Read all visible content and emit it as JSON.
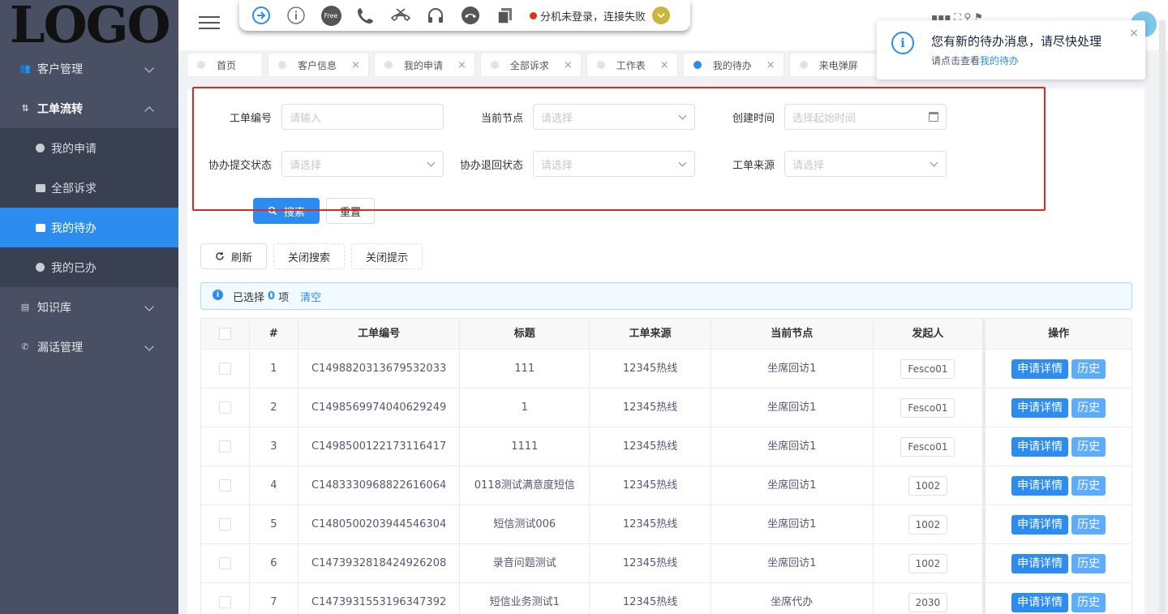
{
  "logo": {
    "text": "LOGO"
  },
  "sidebar": {
    "items": [
      {
        "label": "客户管理",
        "icon": "customer-icon",
        "open": false
      },
      {
        "label": "工单流转",
        "icon": "workflow-icon",
        "open": true,
        "children": [
          {
            "label": "我的申请",
            "icon": "dot-icon"
          },
          {
            "label": "全部诉求",
            "icon": "folder-icon"
          },
          {
            "label": "我的待办",
            "icon": "todo-icon",
            "active": true
          },
          {
            "label": "我的已办",
            "icon": "dot-icon"
          }
        ]
      },
      {
        "label": "知识库",
        "icon": "book-icon",
        "open": false
      },
      {
        "label": "漏话管理",
        "icon": "phone-icon",
        "open": false
      }
    ]
  },
  "phonebar": {
    "free_label": "Free",
    "status_text": "分机未登录，连接失败",
    "icons": [
      "login-icon",
      "info-icon",
      "free-icon",
      "call-icon",
      "hangup-icon",
      "headset-icon",
      "end-call-icon",
      "copy-icon"
    ]
  },
  "header": {
    "right_text": "▪▪▪ ⛶ ⚲ ⚑"
  },
  "tabs": [
    {
      "label": "首页",
      "closable": false,
      "active": false
    },
    {
      "label": "客户信息",
      "closable": true,
      "active": false
    },
    {
      "label": "我的申请",
      "closable": true,
      "active": false
    },
    {
      "label": "全部诉求",
      "closable": true,
      "active": false
    },
    {
      "label": "工作表",
      "closable": true,
      "active": false
    },
    {
      "label": "我的待办",
      "closable": true,
      "active": true
    },
    {
      "label": "来电弹屏",
      "closable": false,
      "active": false
    }
  ],
  "notice": {
    "title": "您有新的待办消息，请尽快处理",
    "desc_prefix": "请点击查看",
    "desc_link": "我的待办",
    "close": "×"
  },
  "search": {
    "fields": [
      {
        "label": "工单编号",
        "placeholder": "请输入",
        "type": "input"
      },
      {
        "label": "当前节点",
        "placeholder": "请选择",
        "type": "select"
      },
      {
        "label": "创建时间",
        "placeholder": "选择起始时间",
        "type": "date"
      },
      {
        "label": "协办提交状态",
        "placeholder": "请选择",
        "type": "select"
      },
      {
        "label": "协办退回状态",
        "placeholder": "请选择",
        "type": "select"
      },
      {
        "label": "工单来源",
        "placeholder": "请选择",
        "type": "select"
      }
    ],
    "search_button": "搜索",
    "reset_button": "重置"
  },
  "toolbar": {
    "refresh": "刷新",
    "close_search": "关闭搜索",
    "close_tip": "关闭提示"
  },
  "selection": {
    "prefix": "已选择",
    "count": "0",
    "suffix": "项",
    "clear": "清空"
  },
  "table": {
    "columns": [
      "",
      "#",
      "工单编号",
      "标题",
      "工单来源",
      "当前节点",
      "发起人",
      "操作"
    ],
    "action_detail": "申请详情",
    "action_history": "历史",
    "rows": [
      {
        "idx": "1",
        "no": "C1498820313679532033",
        "title": "111",
        "source": "12345热线",
        "node": "坐席回访1",
        "initiator": "Fesco01"
      },
      {
        "idx": "2",
        "no": "C1498569974040629249",
        "title": "1",
        "source": "12345热线",
        "node": "坐席回访1",
        "initiator": "Fesco01"
      },
      {
        "idx": "3",
        "no": "C1498500122173116417",
        "title": "1111",
        "source": "12345热线",
        "node": "坐席回访1",
        "initiator": "Fesco01"
      },
      {
        "idx": "4",
        "no": "C1483330968822616064",
        "title": "0118测试满意度短信",
        "source": "12345热线",
        "node": "坐席回访1",
        "initiator": "1002"
      },
      {
        "idx": "5",
        "no": "C1480500203944546304",
        "title": "短信测试006",
        "source": "12345热线",
        "node": "坐席回访1",
        "initiator": "1002"
      },
      {
        "idx": "6",
        "no": "C1473932818424926208",
        "title": "录音问题测试",
        "source": "12345热线",
        "node": "坐席回访1",
        "initiator": "1002"
      },
      {
        "idx": "7",
        "no": "C1473931553196347392",
        "title": "短信业务测试1",
        "source": "12345热线",
        "node": "坐席代办",
        "initiator": "2030"
      }
    ]
  },
  "colors": {
    "accent": "#2d8cf0",
    "sidebar": "#4a5064",
    "highlight": "#e0281c"
  }
}
